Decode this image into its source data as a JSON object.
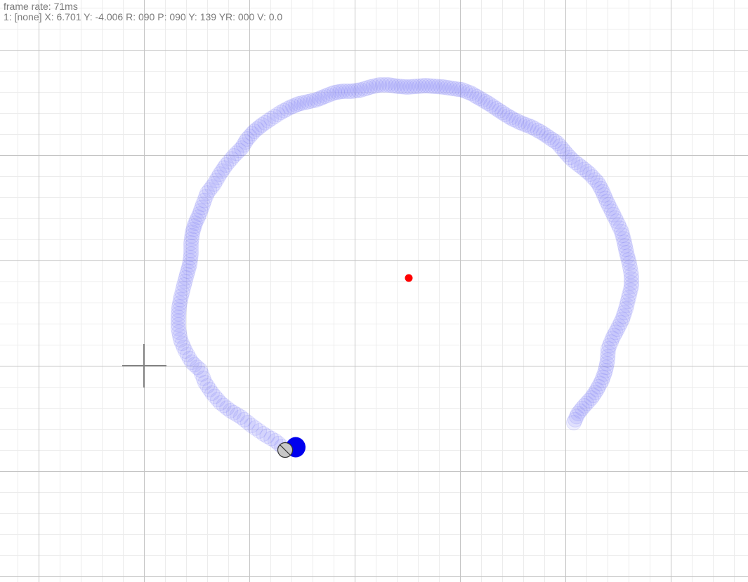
{
  "hud": {
    "frame_rate_line": "frame rate: 71ms",
    "status_line": "1: [none] X: 6.701 Y: -4.006 R: 090 P: 090 Y: 139 YR: 000 V: 0.0"
  },
  "colors": {
    "background": "#ffffff",
    "grid_minor": "#ececec",
    "grid_major": "#c4c4c4",
    "trail": "#6f6ff5",
    "target_dot": "#ff0000",
    "robot_body": "#0000ee",
    "cursor_fill": "#c8c8c8",
    "crosshair": "#808080"
  },
  "icons": {
    "target": "red-dot-icon",
    "robot": "blue-disc-icon",
    "cursor": "circle-slash-icon",
    "crosshair": "crosshair-icon"
  }
}
